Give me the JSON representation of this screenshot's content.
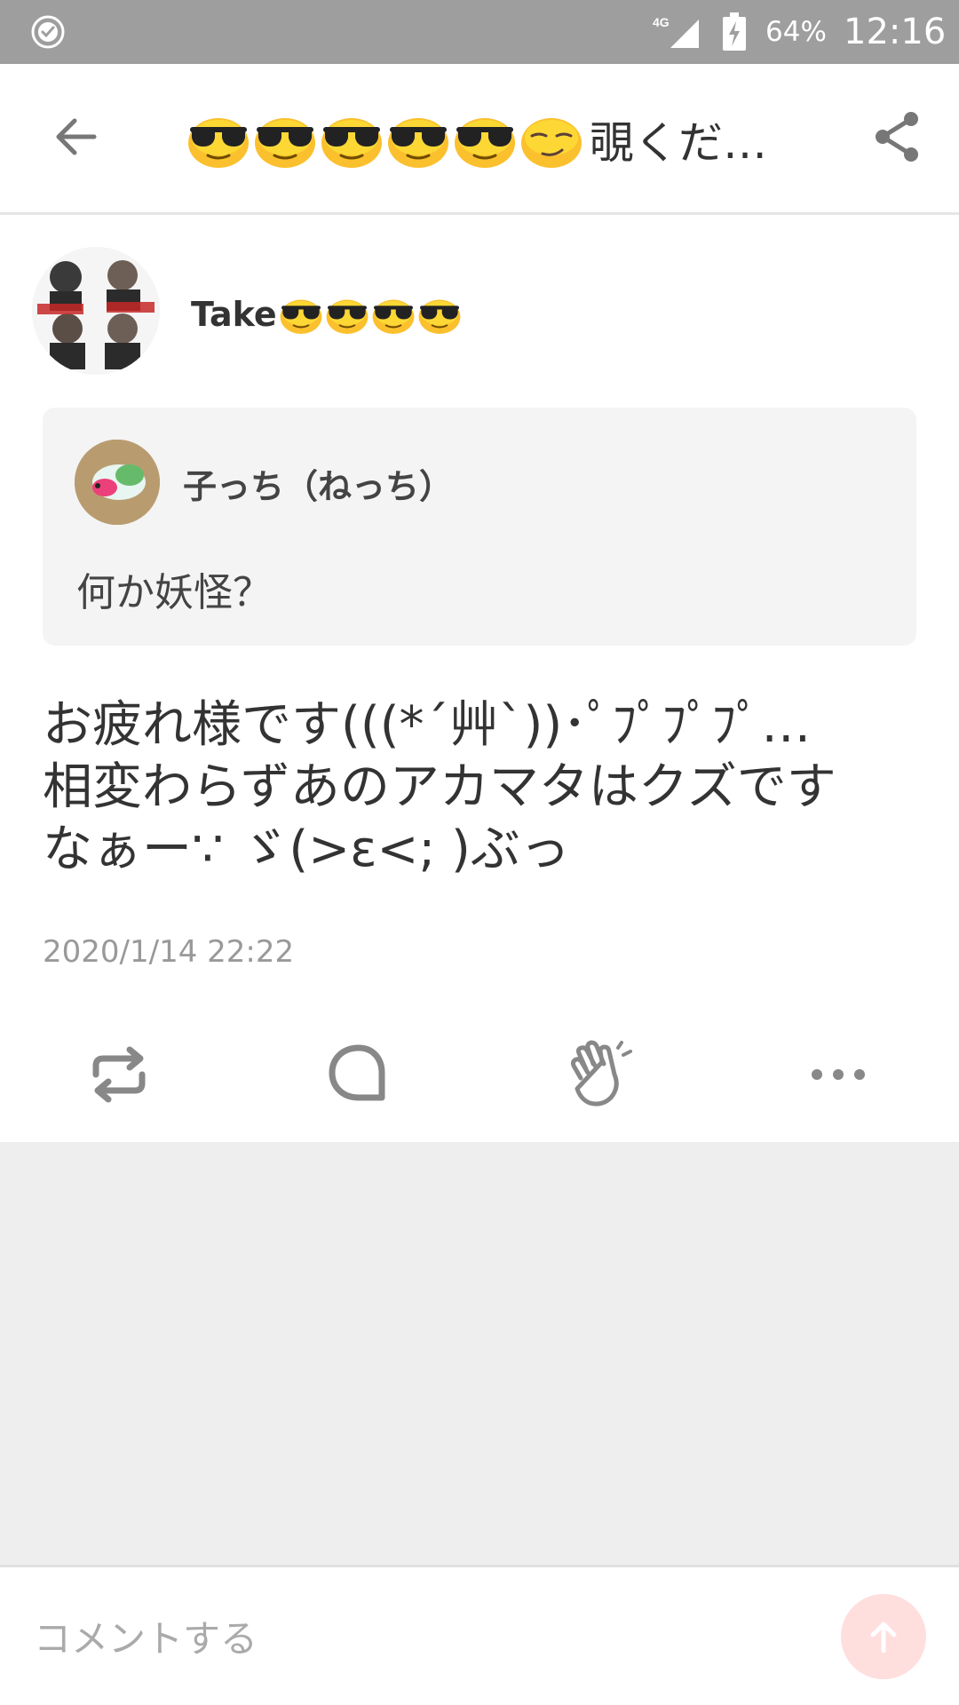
{
  "status_bar": {
    "network": "4G",
    "battery": "64%",
    "time": "12:16"
  },
  "header": {
    "title_emojis": [
      "sunglasses-face",
      "sunglasses-face",
      "sunglasses-face",
      "sunglasses-face",
      "sunglasses-face",
      "smirk-face"
    ],
    "title_text": "覗くだ…",
    "back_icon": "arrow-left-icon",
    "share_icon": "share-icon"
  },
  "post": {
    "author_name": "Take",
    "author_emojis": [
      "sunglasses-face",
      "sunglasses-face",
      "sunglasses-face",
      "sunglasses-face"
    ],
    "quote": {
      "name": "子っち（ねっち）",
      "text": "何か妖怪？"
    },
    "body_lines": [
      "お疲れ様です(((*´艸`))･ﾟﾌﾟﾌﾟﾌﾟ…",
      "相変わらずあのアカマタはクズです",
      "なぁー∵ ゞ(>ε<; )ぶっ"
    ],
    "timestamp": "2020/1/14 22:22"
  },
  "actions": [
    {
      "name": "repost-icon"
    },
    {
      "name": "comment-icon"
    },
    {
      "name": "clap-icon"
    },
    {
      "name": "more-icon"
    }
  ],
  "comment_bar": {
    "placeholder": "コメントする",
    "send_icon": "arrow-up-icon"
  },
  "colors": {
    "status_bar": "#9e9e9e",
    "icon_gray": "#888888",
    "send_button": "#ffdede",
    "empty_area": "#eeeeee"
  }
}
